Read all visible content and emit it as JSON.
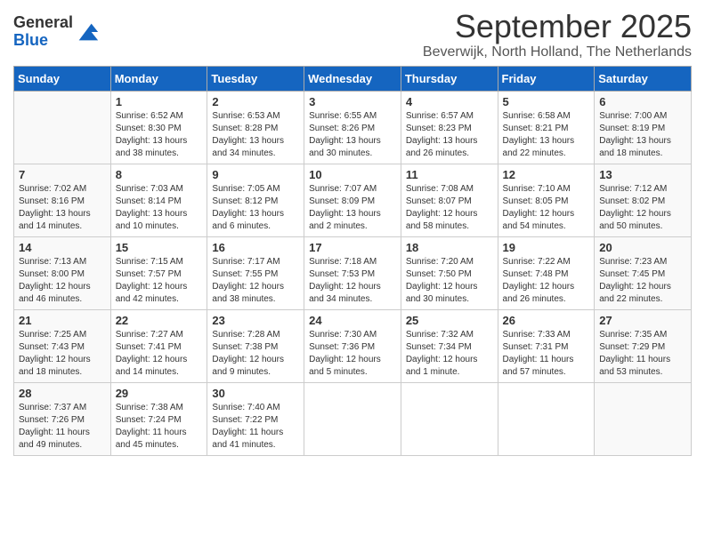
{
  "header": {
    "logo_line1": "General",
    "logo_line2": "Blue",
    "month_title": "September 2025",
    "subtitle": "Beverwijk, North Holland, The Netherlands"
  },
  "days_of_week": [
    "Sunday",
    "Monday",
    "Tuesday",
    "Wednesday",
    "Thursday",
    "Friday",
    "Saturday"
  ],
  "weeks": [
    [
      {
        "day": "",
        "info": ""
      },
      {
        "day": "1",
        "info": "Sunrise: 6:52 AM\nSunset: 8:30 PM\nDaylight: 13 hours\nand 38 minutes."
      },
      {
        "day": "2",
        "info": "Sunrise: 6:53 AM\nSunset: 8:28 PM\nDaylight: 13 hours\nand 34 minutes."
      },
      {
        "day": "3",
        "info": "Sunrise: 6:55 AM\nSunset: 8:26 PM\nDaylight: 13 hours\nand 30 minutes."
      },
      {
        "day": "4",
        "info": "Sunrise: 6:57 AM\nSunset: 8:23 PM\nDaylight: 13 hours\nand 26 minutes."
      },
      {
        "day": "5",
        "info": "Sunrise: 6:58 AM\nSunset: 8:21 PM\nDaylight: 13 hours\nand 22 minutes."
      },
      {
        "day": "6",
        "info": "Sunrise: 7:00 AM\nSunset: 8:19 PM\nDaylight: 13 hours\nand 18 minutes."
      }
    ],
    [
      {
        "day": "7",
        "info": "Sunrise: 7:02 AM\nSunset: 8:16 PM\nDaylight: 13 hours\nand 14 minutes."
      },
      {
        "day": "8",
        "info": "Sunrise: 7:03 AM\nSunset: 8:14 PM\nDaylight: 13 hours\nand 10 minutes."
      },
      {
        "day": "9",
        "info": "Sunrise: 7:05 AM\nSunset: 8:12 PM\nDaylight: 13 hours\nand 6 minutes."
      },
      {
        "day": "10",
        "info": "Sunrise: 7:07 AM\nSunset: 8:09 PM\nDaylight: 13 hours\nand 2 minutes."
      },
      {
        "day": "11",
        "info": "Sunrise: 7:08 AM\nSunset: 8:07 PM\nDaylight: 12 hours\nand 58 minutes."
      },
      {
        "day": "12",
        "info": "Sunrise: 7:10 AM\nSunset: 8:05 PM\nDaylight: 12 hours\nand 54 minutes."
      },
      {
        "day": "13",
        "info": "Sunrise: 7:12 AM\nSunset: 8:02 PM\nDaylight: 12 hours\nand 50 minutes."
      }
    ],
    [
      {
        "day": "14",
        "info": "Sunrise: 7:13 AM\nSunset: 8:00 PM\nDaylight: 12 hours\nand 46 minutes."
      },
      {
        "day": "15",
        "info": "Sunrise: 7:15 AM\nSunset: 7:57 PM\nDaylight: 12 hours\nand 42 minutes."
      },
      {
        "day": "16",
        "info": "Sunrise: 7:17 AM\nSunset: 7:55 PM\nDaylight: 12 hours\nand 38 minutes."
      },
      {
        "day": "17",
        "info": "Sunrise: 7:18 AM\nSunset: 7:53 PM\nDaylight: 12 hours\nand 34 minutes."
      },
      {
        "day": "18",
        "info": "Sunrise: 7:20 AM\nSunset: 7:50 PM\nDaylight: 12 hours\nand 30 minutes."
      },
      {
        "day": "19",
        "info": "Sunrise: 7:22 AM\nSunset: 7:48 PM\nDaylight: 12 hours\nand 26 minutes."
      },
      {
        "day": "20",
        "info": "Sunrise: 7:23 AM\nSunset: 7:45 PM\nDaylight: 12 hours\nand 22 minutes."
      }
    ],
    [
      {
        "day": "21",
        "info": "Sunrise: 7:25 AM\nSunset: 7:43 PM\nDaylight: 12 hours\nand 18 minutes."
      },
      {
        "day": "22",
        "info": "Sunrise: 7:27 AM\nSunset: 7:41 PM\nDaylight: 12 hours\nand 14 minutes."
      },
      {
        "day": "23",
        "info": "Sunrise: 7:28 AM\nSunset: 7:38 PM\nDaylight: 12 hours\nand 9 minutes."
      },
      {
        "day": "24",
        "info": "Sunrise: 7:30 AM\nSunset: 7:36 PM\nDaylight: 12 hours\nand 5 minutes."
      },
      {
        "day": "25",
        "info": "Sunrise: 7:32 AM\nSunset: 7:34 PM\nDaylight: 12 hours\nand 1 minute."
      },
      {
        "day": "26",
        "info": "Sunrise: 7:33 AM\nSunset: 7:31 PM\nDaylight: 11 hours\nand 57 minutes."
      },
      {
        "day": "27",
        "info": "Sunrise: 7:35 AM\nSunset: 7:29 PM\nDaylight: 11 hours\nand 53 minutes."
      }
    ],
    [
      {
        "day": "28",
        "info": "Sunrise: 7:37 AM\nSunset: 7:26 PM\nDaylight: 11 hours\nand 49 minutes."
      },
      {
        "day": "29",
        "info": "Sunrise: 7:38 AM\nSunset: 7:24 PM\nDaylight: 11 hours\nand 45 minutes."
      },
      {
        "day": "30",
        "info": "Sunrise: 7:40 AM\nSunset: 7:22 PM\nDaylight: 11 hours\nand 41 minutes."
      },
      {
        "day": "",
        "info": ""
      },
      {
        "day": "",
        "info": ""
      },
      {
        "day": "",
        "info": ""
      },
      {
        "day": "",
        "info": ""
      }
    ]
  ]
}
